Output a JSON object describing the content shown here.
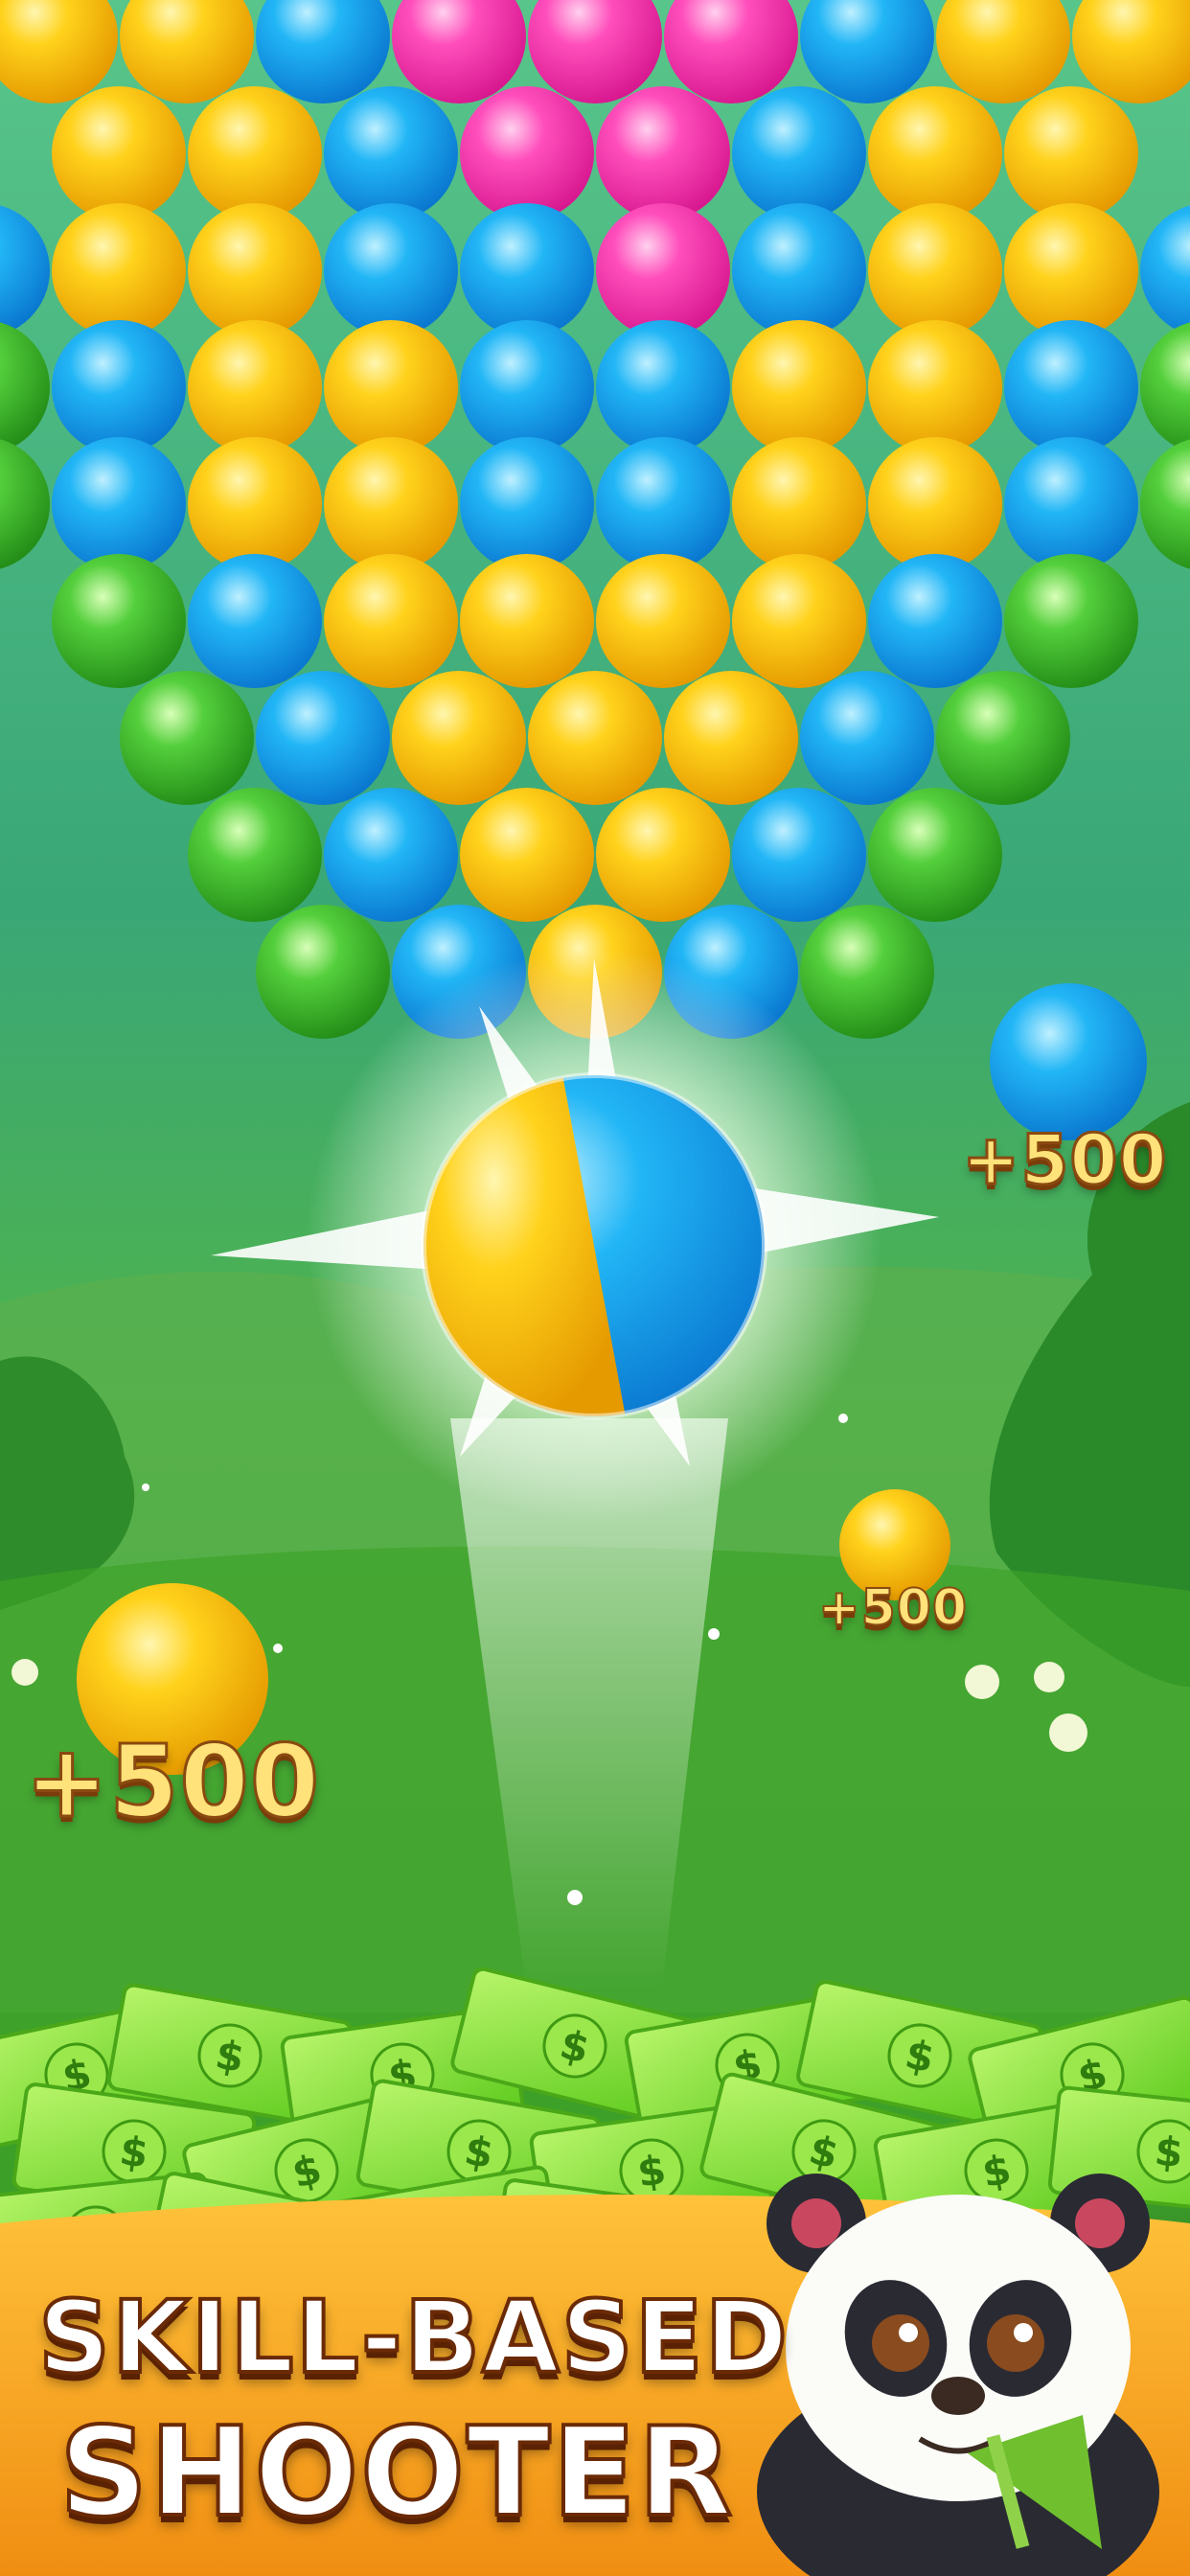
{
  "score_popups": {
    "large": "+500",
    "right": "+500",
    "middle": "+500"
  },
  "tagline": {
    "line1": "SKILL-BASED",
    "line2": "SHOOTER"
  },
  "colors": {
    "yellow": "#f5c400",
    "blue": "#19a8f0",
    "pink": "#ff3fb0",
    "green": "#46c23a",
    "banner": "#f4a625",
    "money": "#7ee03a"
  },
  "bubble_grid": {
    "rows": [
      "YYBPPPBYY",
      "YYBPPBYY",
      "BYYBBPBYYB",
      "GBYYBBYYBG",
      "GBYYBBYYBG",
      "GBYYYYBG",
      "GBYYYBG",
      "GBYYBG",
      "GBYBG"
    ]
  },
  "shooter_bubble": {
    "colors": [
      "yellow",
      "blue"
    ]
  },
  "mascot": "panda"
}
